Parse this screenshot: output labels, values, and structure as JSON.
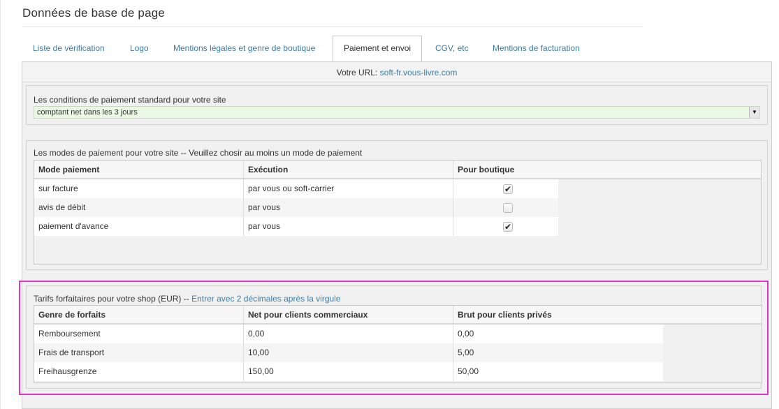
{
  "page": {
    "title": "Données de base de page"
  },
  "tabs": [
    {
      "label": "Liste de vérification",
      "active": false
    },
    {
      "label": "Logo",
      "active": false
    },
    {
      "label": "Mentions légales et genre de boutique",
      "active": false
    },
    {
      "label": "Paiement et envoi",
      "active": true
    },
    {
      "label": "CGV, etc",
      "active": false
    },
    {
      "label": "Mentions de facturation",
      "active": false
    }
  ],
  "url_bar": {
    "label": "Votre URL:",
    "url": "soft-fr.vous-livre.com"
  },
  "payment_terms": {
    "label": "Les conditions de paiement standard pour votre site",
    "selected": "comptant net dans les 3 jours"
  },
  "payment_methods": {
    "label": "Les modes de paiement pour votre site -- Veuillez chosir au moins un mode de paiement",
    "headers": [
      "Mode paiement",
      "Exécution",
      "Pour boutique"
    ],
    "rows": [
      {
        "mode": "sur facture",
        "execution": "par vous ou soft-carrier",
        "checked": true
      },
      {
        "mode": "avis de débit",
        "execution": "par vous",
        "checked": false
      },
      {
        "mode": "paiement d'avance",
        "execution": "par vous",
        "checked": true
      }
    ]
  },
  "flat_rates": {
    "label": "Tarifs forfaitaires pour votre shop (EUR) --",
    "hint": "Entrer avec 2 décimales après la virgule",
    "headers": [
      "Genre de forfaits",
      "Net pour clients commerciaux",
      "Brut pour clients privés"
    ],
    "rows": [
      {
        "type": "Remboursement",
        "net": "0,00",
        "brut": "0,00"
      },
      {
        "type": "Frais de transport",
        "net": "10,00",
        "brut": "5,00"
      },
      {
        "type": "Freihausgrenze",
        "net": "150,00",
        "brut": "50,00"
      }
    ]
  },
  "colors": {
    "link": "#3a7ca8",
    "highlight_border": "#e333c8",
    "select_bg": "#eaf8e4"
  }
}
